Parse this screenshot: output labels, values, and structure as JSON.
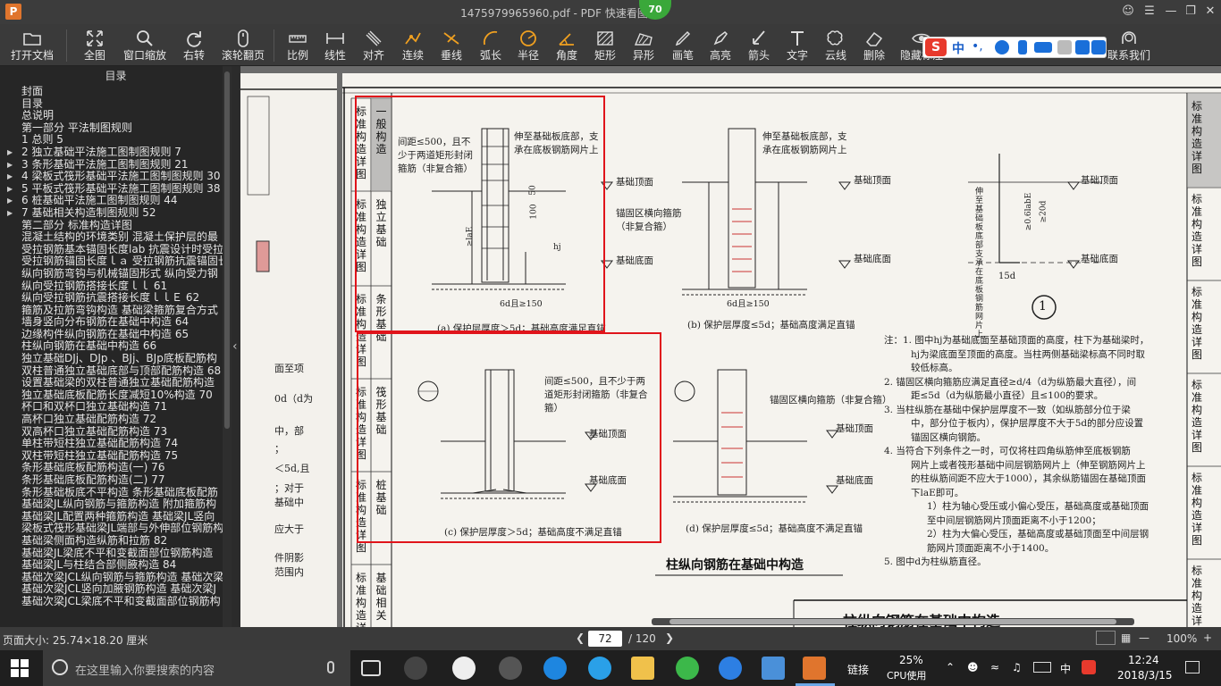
{
  "window": {
    "title": "1475979965960.pdf - PDF 快速看图",
    "badge": "70",
    "app_icon": "P"
  },
  "toolbar": [
    {
      "name": "open-file",
      "label": "打开文档",
      "icon": "folder-icon"
    },
    {
      "name": "fit-all",
      "label": "全图",
      "icon": "expand-icon"
    },
    {
      "name": "window-zoom",
      "label": "窗口缩放",
      "icon": "magnifier-icon"
    },
    {
      "name": "rotate-right",
      "label": "右转",
      "icon": "rotate-icon"
    },
    {
      "name": "scroll-page",
      "label": "滚轮翻页",
      "icon": "mouse-icon"
    },
    {
      "name": "scale",
      "label": "比例",
      "icon": "ruler-icon"
    },
    {
      "name": "linear",
      "label": "线性",
      "icon": "linear-dim-icon"
    },
    {
      "name": "align",
      "label": "对齐",
      "icon": "aligned-dim-icon"
    },
    {
      "name": "continuous",
      "label": "连续",
      "icon": "polyline-icon"
    },
    {
      "name": "perpendicular",
      "label": "垂线",
      "icon": "perpendicular-icon"
    },
    {
      "name": "arc-length",
      "label": "弧长",
      "icon": "arc-icon"
    },
    {
      "name": "radius",
      "label": "半径",
      "icon": "circle-radius-icon"
    },
    {
      "name": "angle",
      "label": "角度",
      "icon": "angle-icon"
    },
    {
      "name": "rectangle",
      "label": "矩形",
      "icon": "rect-hatch-icon"
    },
    {
      "name": "irregular",
      "label": "异形",
      "icon": "polygon-hatch-icon"
    },
    {
      "name": "pen",
      "label": "画笔",
      "icon": "pen-icon"
    },
    {
      "name": "highlight",
      "label": "高亮",
      "icon": "highlighter-icon"
    },
    {
      "name": "arrow",
      "label": "箭头",
      "icon": "arrow-icon"
    },
    {
      "name": "text",
      "label": "文字",
      "icon": "text-icon"
    },
    {
      "name": "cloud",
      "label": "云线",
      "icon": "cloud-icon"
    },
    {
      "name": "delete",
      "label": "删除",
      "icon": "eraser-icon"
    },
    {
      "name": "hide-markup",
      "label": "隐藏标注",
      "icon": "eye-icon"
    },
    {
      "name": "contact-us",
      "label": "联系我们",
      "icon": "support-icon"
    }
  ],
  "ime": {
    "logo": "S",
    "lang": "中",
    "punct": "•,"
  },
  "sidebar": {
    "header": "目录",
    "items": [
      {
        "text": "封面",
        "exp": ""
      },
      {
        "text": "目录",
        "exp": ""
      },
      {
        "text": "总说明",
        "exp": ""
      },
      {
        "text": "第一部分 平法制图规则",
        "exp": ""
      },
      {
        "text": "1 总则 5",
        "exp": ""
      },
      {
        "text": "2 独立基础平法施工图制图规则 7",
        "exp": "▶"
      },
      {
        "text": "3 条形基础平法施工图制图规则 21",
        "exp": "▶"
      },
      {
        "text": "4 梁板式筏形基础平法施工图制图规则 30",
        "exp": "▶"
      },
      {
        "text": "5 平板式筏形基础平法施工图制图规则 38",
        "exp": "▶"
      },
      {
        "text": "6 桩基础平法施工图制图规则 44",
        "exp": "▶"
      },
      {
        "text": "7 基础相关构造制图规则 52",
        "exp": "▶"
      },
      {
        "text": "第二部分 标准构造详图",
        "exp": ""
      },
      {
        "text": "混凝土结构的环境类别 混凝土保护层的最",
        "exp": ""
      },
      {
        "text": "受拉钢筋基本锚固长度lab 抗震设计时受拉",
        "exp": ""
      },
      {
        "text": "受拉钢筋锚固长度ｌａ 受拉钢筋抗震锚固长",
        "exp": ""
      },
      {
        "text": "纵向钢筋弯钩与机械锚固形式 纵向受力钢",
        "exp": ""
      },
      {
        "text": "纵向受拉钢筋搭接长度ｌｌ 61",
        "exp": ""
      },
      {
        "text": "纵向受拉钢筋抗震搭接长度ｌｌＥ 62",
        "exp": ""
      },
      {
        "text": "箍筋及拉筋弯钩构造 基础梁箍筋复合方式",
        "exp": ""
      },
      {
        "text": "墙身竖向分布钢筋在基础中构造 64",
        "exp": ""
      },
      {
        "text": "边缘构件纵向钢筋在基础中构造 65",
        "exp": ""
      },
      {
        "text": "柱纵向钢筋在基础中构造 66",
        "exp": ""
      },
      {
        "text": "独立基础DJj、DJp 、BJj、BJp底板配筋构",
        "exp": ""
      },
      {
        "text": "双柱普通独立基础底部与顶部配筋构造 68",
        "exp": ""
      },
      {
        "text": "设置基础梁的双柱普通独立基础配筋构造",
        "exp": ""
      },
      {
        "text": "独立基础底板配筋长度减短10%构造 70",
        "exp": ""
      },
      {
        "text": "杯口和双杯口独立基础构造 71",
        "exp": ""
      },
      {
        "text": "高杯口独立基础配筋构造 72",
        "exp": ""
      },
      {
        "text": "双高杯口独立基础配筋构造 73",
        "exp": ""
      },
      {
        "text": "单柱带短柱独立基础配筋构造 74",
        "exp": ""
      },
      {
        "text": "双柱带短柱独立基础配筋构造 75",
        "exp": ""
      },
      {
        "text": "条形基础底板配筋构造(一) 76",
        "exp": ""
      },
      {
        "text": "条形基础底板配筋构造(二) 77",
        "exp": ""
      },
      {
        "text": "条形基础板底不平构造 条形基础底板配筋",
        "exp": ""
      },
      {
        "text": "基础梁JL纵向钢筋与箍筋构造 附加箍筋构",
        "exp": ""
      },
      {
        "text": "基础梁JL配置两种箍筋构造 基础梁JL竖向",
        "exp": ""
      },
      {
        "text": "梁板式筏形基础梁JL端部与外伸部位钢筋构",
        "exp": ""
      },
      {
        "text": "基础梁侧面构造纵筋和拉筋 82",
        "exp": ""
      },
      {
        "text": "基础梁JL梁底不平和变截面部位钢筋构造",
        "exp": ""
      },
      {
        "text": "基础梁JL与柱结合部侧腋构造 84",
        "exp": ""
      },
      {
        "text": "基础次梁JCL纵向钢筋与箍筋构造 基础次梁",
        "exp": ""
      },
      {
        "text": "基础次梁JCL竖向加腋钢筋构造 基础次梁J",
        "exp": ""
      },
      {
        "text": "基础次梁JCL梁底不平和变截面部位钢筋构",
        "exp": ""
      }
    ]
  },
  "left_page": {
    "fragments": [
      "面至项",
      "0d（d为",
      "中，部",
      "；",
      "＜5d,且",
      "；对于",
      "基础中",
      "应大于",
      "件阴影",
      "范围内"
    ]
  },
  "document": {
    "side_tabs_left": [
      "标准构造详图",
      "一般构造",
      "标准构造详图",
      "独立基础",
      "标准构造详图",
      "条形基础",
      "标准构造详图",
      "筏形基础",
      "标准构造详图",
      "桩基础",
      "标准构造详图",
      "基础相关"
    ],
    "side_tabs_right": [
      "标准构造详图",
      "标准构造详图",
      "标准构造详图",
      "标准构造详图",
      "标准构造详图",
      "标准构造详图"
    ],
    "note_a": "间距≤500，且不少于两道矩形封闭箍筋（非复合箍）",
    "note_a2": "伸至基础板底部，支承在底板钢筋网片上",
    "note_b": "伸至基础板底部，支承在底板钢筋网片上",
    "top_label": "基础顶面",
    "bottom_label": "基础底面",
    "anchor_label": "锚固区横向箍筋（非复合箍）",
    "anchor_label2": "锚固区横向箍筋（非复合箍）",
    "note_c": "间距≤500，且不少于两道矩形封闭箍筋（非复合箍）",
    "caption_a": "(a) 保护层厚度＞5d；基础高度满足直锚",
    "caption_b": "(b) 保护层厚度≤5d；基础高度满足直锚",
    "caption_c": "(c) 保护层厚度＞5d；基础高度不满足直锚",
    "caption_d": "(d) 保护层厚度≤5d；基础高度不满足直锚",
    "dim_6d": "6d且≥150",
    "dim_150": "150",
    "dim_100": "100",
    "dim_15d": "15d",
    "dim_lae": "≥laE",
    "dim_hj": "hj",
    "dim_06": "≥0.6labE",
    "dim_20d": "≥20d",
    "vert_note": "伸至基础板底部支承在底板钢筋网片上",
    "circle1": "1",
    "main_title": "柱纵向钢筋在基础中构造",
    "bottom_title": "柱纵向钢筋在基础中构造",
    "notes": [
      "注：1. 图中hj为基础底面至基础顶面的高度，柱下为基础梁时，",
      "hj为梁底面至顶面的高度。当柱两侧基础梁标高不同时取",
      "较低标高。",
      "2. 锚固区横向箍筋应满足直径≥d/4（d为纵筋最大直径），间",
      "距≤5d（d为纵筋最小直径）且≤100的要求。",
      "3. 当柱纵筋在基础中保护层厚度不一致（如纵筋部分位于梁",
      "中，部分位于板内），保护层厚度不大于5d的部分应设置",
      "锚固区横向钢筋。",
      "4. 当符合下列条件之一时，可仅将柱四角纵筋伸至底板钢筋",
      "网片上或者筏形基础中间层钢筋网片上（伸至钢筋网片上",
      "的柱纵筋间距不应大于1000），其余纵筋锚固在基础顶面",
      "下laE即可。",
      "1）柱为轴心受压或小偏心受压，基础高度或基础顶面",
      "至中间层钢筋网片顶面距离不小于1200；",
      "2）柱为大偏心受压，基础高度或基础顶面至中间层钢",
      "筋网片顶面距离不小于1400。",
      "5. 图中d为柱纵筋直径。"
    ]
  },
  "status": {
    "page_size": "页面大小: 25.74×18.20 厘米",
    "current_page": "72",
    "total": "/ 120",
    "zoom": "100%"
  },
  "taskbar": {
    "search_placeholder": "在这里输入你要搜索的内容",
    "link_label": "链接",
    "cpu": "25%",
    "cpu_label": "CPU使用",
    "ime": "中",
    "time": "12:24",
    "date": "2018/3/15"
  }
}
